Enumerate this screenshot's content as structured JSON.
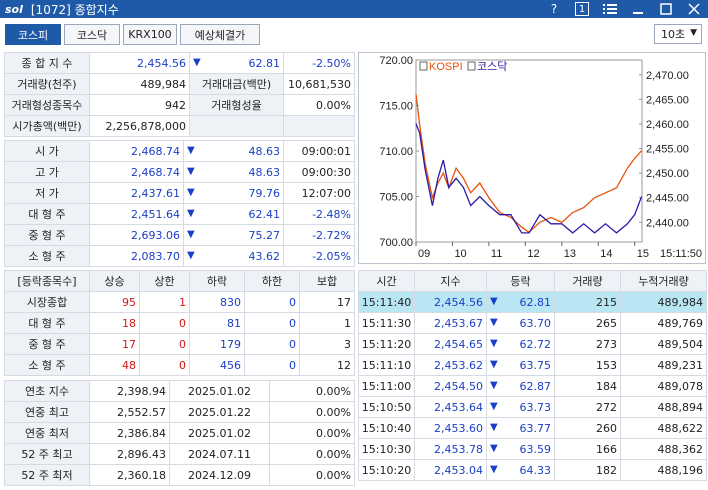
{
  "window": {
    "logo": "sol",
    "title": "[1072] 종합지수",
    "help": "?",
    "page_num": "1"
  },
  "tabs": [
    {
      "label": "코스피",
      "active": true
    },
    {
      "label": "코스닥",
      "active": false
    },
    {
      "label": "KRX100",
      "active": false
    },
    {
      "label": "예상체결가",
      "active": false
    }
  ],
  "interval": "10초",
  "summary": {
    "index_label": "종 합 지 수",
    "index_value": "2,454.56",
    "change_icon": "down-triangle",
    "change": "62.81",
    "change_pct": "-2.50%",
    "volume_label": "거래량(천주)",
    "volume": "489,984",
    "amount_label": "거래대금(백만)",
    "amount": "10,681,530",
    "formed_count_label": "거래형성종목수",
    "formed_count": "942",
    "formed_rate_label": "거래형성율",
    "formed_rate": "0.00%",
    "mktcap_label": "시가총액(백만)",
    "mktcap": "2,256,878,000"
  },
  "price_rows": [
    {
      "label": "시 가",
      "value": "2,468.74",
      "icon": "down-triangle",
      "change": "48.63",
      "extra": "09:00:01",
      "extra_color": "black"
    },
    {
      "label": "고 가",
      "value": "2,468.74",
      "icon": "down-triangle",
      "change": "48.63",
      "extra": "09:00:30",
      "extra_color": "black"
    },
    {
      "label": "저 가",
      "value": "2,437.61",
      "icon": "down-triangle",
      "change": "79.76",
      "extra": "12:07:00",
      "extra_color": "black"
    },
    {
      "label": "대 형 주",
      "value": "2,451.64",
      "icon": "down-triangle",
      "change": "62.41",
      "extra": "-2.48%",
      "extra_color": "blue"
    },
    {
      "label": "중 형 주",
      "value": "2,693.06",
      "icon": "down-triangle",
      "change": "75.27",
      "extra": "-2.72%",
      "extra_color": "blue"
    },
    {
      "label": "소 형 주",
      "value": "2,083.70",
      "icon": "down-triangle",
      "change": "43.62",
      "extra": "-2.05%",
      "extra_color": "blue"
    }
  ],
  "breadth": {
    "headers": [
      "[등락종목수]",
      "상승",
      "상한",
      "하락",
      "하한",
      "보합"
    ],
    "rows": [
      {
        "label": "시장종합",
        "up": "95",
        "upper": "1",
        "down": "830",
        "lower": "0",
        "flat": "17"
      },
      {
        "label": "대 형 주",
        "up": "18",
        "upper": "0",
        "down": "81",
        "lower": "0",
        "flat": "1"
      },
      {
        "label": "중 형 주",
        "up": "17",
        "upper": "0",
        "down": "179",
        "lower": "0",
        "flat": "3"
      },
      {
        "label": "소 형 주",
        "up": "48",
        "upper": "0",
        "down": "456",
        "lower": "0",
        "flat": "12"
      }
    ]
  },
  "extremes": [
    {
      "label": "연초 지수",
      "value": "2,398.94",
      "date": "2025.01.02",
      "pct": "0.00%"
    },
    {
      "label": "연중 최고",
      "value": "2,552.57",
      "date": "2025.01.22",
      "pct": "0.00%"
    },
    {
      "label": "연중 최저",
      "value": "2,386.84",
      "date": "2025.01.02",
      "pct": "0.00%"
    },
    {
      "label": "52 주 최고",
      "value": "2,896.43",
      "date": "2024.07.11",
      "pct": "0.00%"
    },
    {
      "label": "52 주 최저",
      "value": "2,360.18",
      "date": "2024.12.09",
      "pct": "0.00%"
    }
  ],
  "ticks": {
    "headers": [
      "시간",
      "지수",
      "등락",
      "거래량",
      "누적거래량"
    ],
    "rows": [
      {
        "time": "15:11:40",
        "index": "2,454.56",
        "change": "62.81",
        "vol": "215",
        "cum": "489,984"
      },
      {
        "time": "15:11:30",
        "index": "2,453.67",
        "change": "63.70",
        "vol": "265",
        "cum": "489,769"
      },
      {
        "time": "15:11:20",
        "index": "2,454.65",
        "change": "62.72",
        "vol": "273",
        "cum": "489,504"
      },
      {
        "time": "15:11:10",
        "index": "2,453.62",
        "change": "63.75",
        "vol": "153",
        "cum": "489,231"
      },
      {
        "time": "15:11:00",
        "index": "2,454.50",
        "change": "62.87",
        "vol": "184",
        "cum": "489,078"
      },
      {
        "time": "15:10:50",
        "index": "2,453.64",
        "change": "63.73",
        "vol": "272",
        "cum": "488,894"
      },
      {
        "time": "15:10:40",
        "index": "2,453.60",
        "change": "63.77",
        "vol": "260",
        "cum": "488,622"
      },
      {
        "time": "15:10:30",
        "index": "2,453.78",
        "change": "63.59",
        "vol": "166",
        "cum": "488,362"
      },
      {
        "time": "15:10:20",
        "index": "2,453.04",
        "change": "64.33",
        "vol": "182",
        "cum": "488,196"
      }
    ]
  },
  "colors": {
    "accent": "#1e5aa8",
    "up": "#d01818",
    "down": "#1a3fc7",
    "kospi_line": "#e8520a",
    "kosdaq_line": "#2a1aa8"
  },
  "chart_data": {
    "type": "line",
    "legend": [
      "KOSPI",
      "코스닥"
    ],
    "left_axis_ticks": [
      "720.00",
      "715.00",
      "710.00",
      "705.00",
      "700.00"
    ],
    "right_axis_ticks": [
      "2,470.00",
      "2,465.00",
      "2,460.00",
      "2,455.00",
      "2,450.00",
      "2,445.00",
      "2,440.00"
    ],
    "x_ticks": [
      "09",
      "10",
      "11",
      "12",
      "13",
      "14",
      "15"
    ],
    "current_time": "15:11:50",
    "left_ylim": [
      700,
      720
    ],
    "right_ylim": [
      2436,
      2473
    ],
    "series": [
      {
        "name": "KOSPI",
        "axis": "right",
        "x": [
          9.0,
          9.1,
          9.25,
          9.45,
          9.6,
          9.75,
          9.9,
          10.1,
          10.3,
          10.5,
          10.75,
          11.0,
          11.3,
          11.6,
          11.9,
          12.1,
          12.4,
          12.7,
          13.0,
          13.3,
          13.6,
          13.9,
          14.2,
          14.5,
          14.8,
          15.0,
          15.19
        ],
        "y": [
          2466,
          2460,
          2452,
          2445,
          2448,
          2450,
          2447,
          2451,
          2449,
          2446,
          2448,
          2445,
          2442,
          2441,
          2439,
          2438,
          2440,
          2441,
          2440,
          2442,
          2443,
          2445,
          2446,
          2447,
          2451,
          2453,
          2454.56
        ]
      },
      {
        "name": "코스닥",
        "axis": "left",
        "x": [
          9.0,
          9.1,
          9.25,
          9.45,
          9.6,
          9.75,
          9.9,
          10.1,
          10.3,
          10.5,
          10.75,
          11.0,
          11.3,
          11.6,
          11.9,
          12.1,
          12.4,
          12.7,
          13.0,
          13.3,
          13.6,
          13.9,
          14.2,
          14.5,
          14.8,
          15.0,
          15.19
        ],
        "y": [
          713,
          712,
          708,
          704,
          707,
          709,
          706,
          707,
          706,
          704,
          705,
          704,
          703,
          703,
          701,
          701,
          703,
          702,
          702,
          701,
          702,
          701,
          702,
          701,
          702,
          703,
          705
        ]
      }
    ]
  }
}
